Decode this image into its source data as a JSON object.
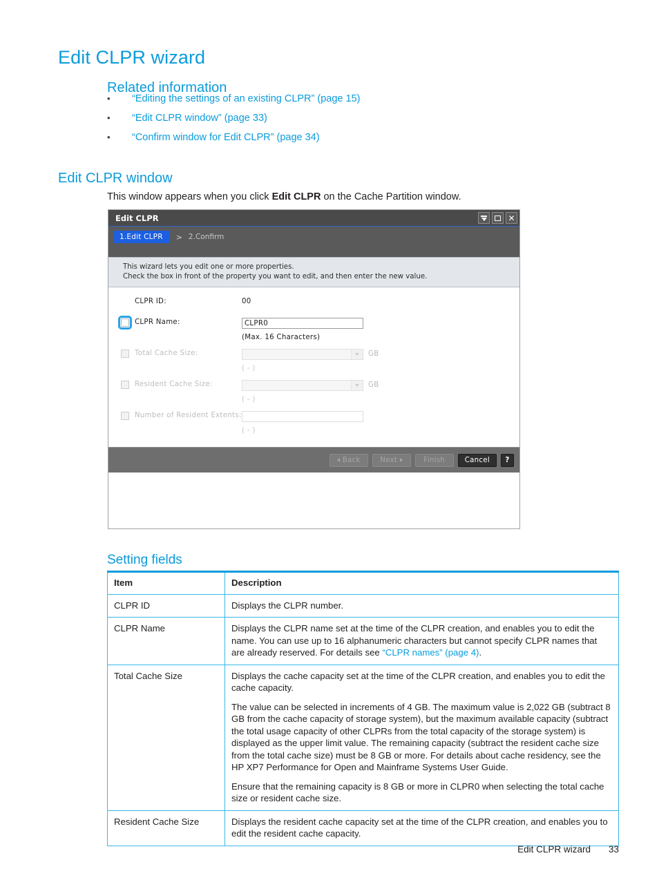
{
  "page": {
    "title": "Edit CLPR wizard",
    "footer_label": "Edit CLPR wizard",
    "footer_page_number": "33",
    "accent_color": "#0a9bdc",
    "table_border_color": "#39b7e8"
  },
  "related": {
    "heading": "Related information",
    "bullet": "•",
    "links": [
      "“Editing the settings of an existing CLPR” (page 15)",
      "“Edit CLPR window” (page 33)",
      "“Confirm window for Edit CLPR” (page 34)"
    ]
  },
  "section": {
    "heading": "Edit CLPR window",
    "intro_before": "This window appears when you click ",
    "intro_bold": "Edit CLPR",
    "intro_after": " on the Cache Partition window."
  },
  "dialog": {
    "title": "Edit CLPR",
    "titlebar_icons": [
      "pin-icon",
      "maximize-icon",
      "close-icon"
    ],
    "close_glyph": "✕",
    "steps": {
      "active": "1.Edit CLPR",
      "separator": ">",
      "next": "2.Confirm"
    },
    "banner": [
      "This wizard lets you edit one or more properties.",
      "Check the box in front of the property you want to edit, and then enter the new value."
    ],
    "fields": [
      {
        "label": "CLPR ID:",
        "value": "00"
      },
      {
        "label": "CLPR Name:",
        "value": "CLPR0",
        "hint": "(Max. 16 Characters)"
      },
      {
        "label": "Total Cache Size:",
        "value": "",
        "unit": "GB",
        "hint": "( - )"
      },
      {
        "label": "Resident Cache Size:",
        "value": "",
        "unit": "GB",
        "hint": "( - )"
      },
      {
        "label": "Number of Resident Extents:",
        "value": "",
        "hint": "( - )"
      }
    ],
    "buttons": {
      "back": "Back",
      "next": "Next",
      "finish": "Finish",
      "cancel": "Cancel",
      "help": "?"
    }
  },
  "setting_fields": {
    "heading": "Setting fields",
    "columns": [
      "Item",
      "Description"
    ],
    "rows": [
      {
        "item": "CLPR ID",
        "paragraphs": [
          "Displays the CLPR number."
        ]
      },
      {
        "item": "CLPR Name",
        "paragraphs": [
          "Displays the CLPR name set at the time of the CLPR creation, and enables you to edit the name. You can use up to 16 alphanumeric characters but cannot specify CLPR names that are already reserved. For details see "
        ],
        "link_text": "“CLPR names” (page 4)",
        "link_tail": "."
      },
      {
        "item": "Total Cache Size",
        "paragraphs": [
          "Displays the cache capacity set at the time of the CLPR creation, and enables you to edit the cache capacity.",
          "The value can be selected in increments of 4 GB. The maximum value is 2,022 GB (subtract 8 GB from the cache capacity of storage system), but the maximum available capacity (subtract the total usage capacity of other CLPRs from the total capacity of the storage system) is displayed as the upper limit value. The remaining capacity (subtract the resident cache size from the total cache size) must be 8 GB or more. For details about cache residency, see the HP XP7 Performance for Open and Mainframe Systems User Guide.",
          "Ensure that the remaining capacity is 8 GB or more in CLPR0 when selecting the total cache size or resident cache size."
        ]
      },
      {
        "item": "Resident Cache Size",
        "paragraphs": [
          "Displays the resident cache capacity set at the time of the CLPR creation, and enables you to edit the resident cache capacity."
        ]
      }
    ]
  }
}
